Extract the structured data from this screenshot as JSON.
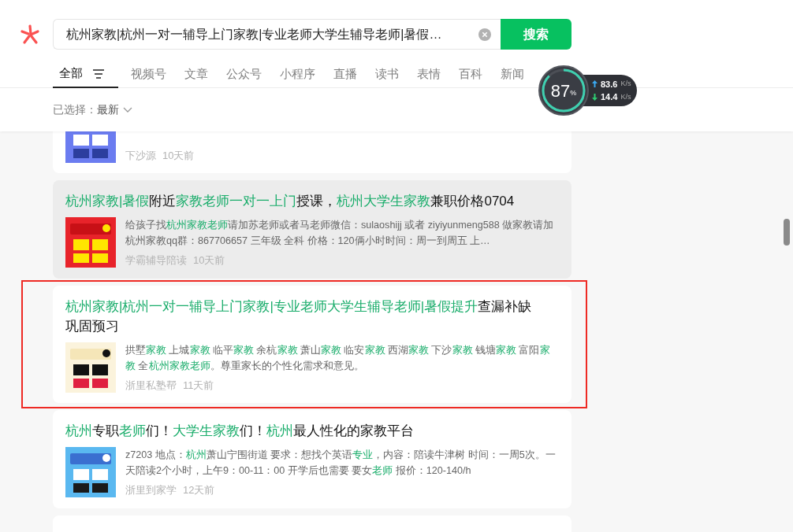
{
  "search": {
    "value": "杭州家教|杭州一对一辅导上门家教|专业老师大学生辅导老师|暑假…",
    "button": "搜索"
  },
  "tabs": [
    {
      "label": "全部",
      "selected": true
    },
    {
      "label": "视频号",
      "selected": false
    },
    {
      "label": "文章",
      "selected": false
    },
    {
      "label": "公众号",
      "selected": false
    },
    {
      "label": "小程序",
      "selected": false
    },
    {
      "label": "直播",
      "selected": false
    },
    {
      "label": "读书",
      "selected": false
    },
    {
      "label": "表情",
      "selected": false
    },
    {
      "label": "百科",
      "selected": false
    },
    {
      "label": "新闻",
      "selected": false
    }
  ],
  "filter": {
    "label": "已选择：",
    "value": "最新"
  },
  "results": [
    {
      "source": "下沙源",
      "time": "10天前",
      "hovered": false,
      "outlined": false
    },
    {
      "title": [
        {
          "t": "杭州家教|暑假",
          "hl": true
        },
        {
          "t": "附近",
          "hl": false
        },
        {
          "t": "家教老师一对一上门",
          "hl": true
        },
        {
          "t": "授课，",
          "hl": false
        },
        {
          "t": "杭州大学生家教",
          "hl": true
        },
        {
          "t": "兼职价格0704",
          "hl": false
        }
      ],
      "snippet": [
        {
          "t": "给孩子找",
          "hl": false
        },
        {
          "t": "杭州家教老师",
          "hl": true
        },
        {
          "t": "请加苏老师或者马老师微信：sulaoshijj 或者 ziyiyunmeng588 做家教请加杭州家教qq群：867706657 三年级 全科 价格：120俩小时时间：周一到周五 上…",
          "hl": false
        }
      ],
      "source": "学霸辅导陪读",
      "time": "10天前",
      "hovered": true,
      "outlined": false
    },
    {
      "title": [
        {
          "t": "杭州家教|杭州一对一辅导上门家教|专业老师大学生辅导老师|暑假提升",
          "hl": true
        },
        {
          "t": "查漏补缺巩固预习",
          "hl": false
        }
      ],
      "snippet": [
        {
          "t": "拱墅",
          "hl": false
        },
        {
          "t": "家教",
          "hl": true
        },
        {
          "t": " 上城",
          "hl": false
        },
        {
          "t": "家教",
          "hl": true
        },
        {
          "t": " 临平",
          "hl": false
        },
        {
          "t": "家教",
          "hl": true
        },
        {
          "t": " 余杭",
          "hl": false
        },
        {
          "t": "家教",
          "hl": true
        },
        {
          "t": " 萧山",
          "hl": false
        },
        {
          "t": "家教",
          "hl": true
        },
        {
          "t": " 临安",
          "hl": false
        },
        {
          "t": "家教",
          "hl": true
        },
        {
          "t": " 西湖",
          "hl": false
        },
        {
          "t": "家教",
          "hl": true
        },
        {
          "t": " 下沙",
          "hl": false
        },
        {
          "t": "家教",
          "hl": true
        },
        {
          "t": " 钱塘",
          "hl": false
        },
        {
          "t": "家教",
          "hl": true
        },
        {
          "t": " 富阳",
          "hl": false
        },
        {
          "t": "家教",
          "hl": true
        },
        {
          "t": " 全",
          "hl": false
        },
        {
          "t": "杭州家教老师",
          "hl": true
        },
        {
          "t": "。尊重家长的个性化需求和意见。",
          "hl": false
        }
      ],
      "source": "浙里私塾帮",
      "time": "11天前",
      "hovered": false,
      "outlined": true
    },
    {
      "title": [
        {
          "t": "杭州",
          "hl": true
        },
        {
          "t": "专职",
          "hl": false
        },
        {
          "t": "老师",
          "hl": true
        },
        {
          "t": "们！",
          "hl": false
        },
        {
          "t": "大学生家教",
          "hl": true
        },
        {
          "t": "们！",
          "hl": false
        },
        {
          "t": "杭州",
          "hl": true
        },
        {
          "t": "最人性化的家教平台",
          "hl": false
        }
      ],
      "snippet": [
        {
          "t": "z7203 地点：",
          "hl": false
        },
        {
          "t": "杭州",
          "hl": true
        },
        {
          "t": "萧山宁围街道 要求：想找个英语",
          "hl": false
        },
        {
          "t": "专业",
          "hl": true
        },
        {
          "t": "，内容：陪读牛津树 时间：一周5次。一天陪读2个小时，上午9：00-11：00 开学后也需要 要女",
          "hl": false
        },
        {
          "t": "老师",
          "hl": true
        },
        {
          "t": " 报价：120-140/h",
          "hl": false
        }
      ],
      "source": "浙里到家学",
      "time": "12天前",
      "hovered": false,
      "outlined": false
    }
  ],
  "net_monitor": {
    "percent": "87",
    "percent_unit": "%",
    "upload": "83.6",
    "upload_unit": "K/s",
    "download": "14.4",
    "download_unit": "K/s"
  }
}
